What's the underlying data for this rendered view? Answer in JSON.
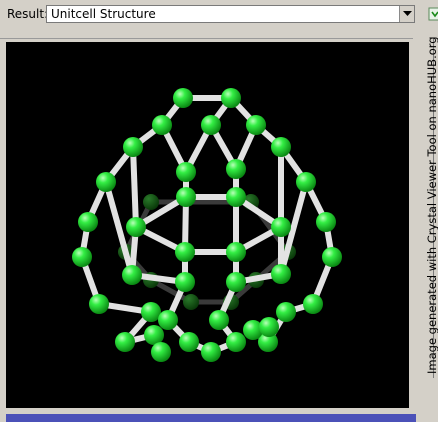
{
  "result": {
    "label": "Result:",
    "selected": "Unitcell Structure"
  },
  "viewer": {
    "credit": "Image generated with Crystal Viewer Tool on nanoHUB.org",
    "background": "#000000",
    "atom_color": "#22dd33",
    "bond_color": "#e6e6e6"
  },
  "icons": {
    "dropdown": "chevron-down-icon",
    "tool": "download-icon"
  }
}
